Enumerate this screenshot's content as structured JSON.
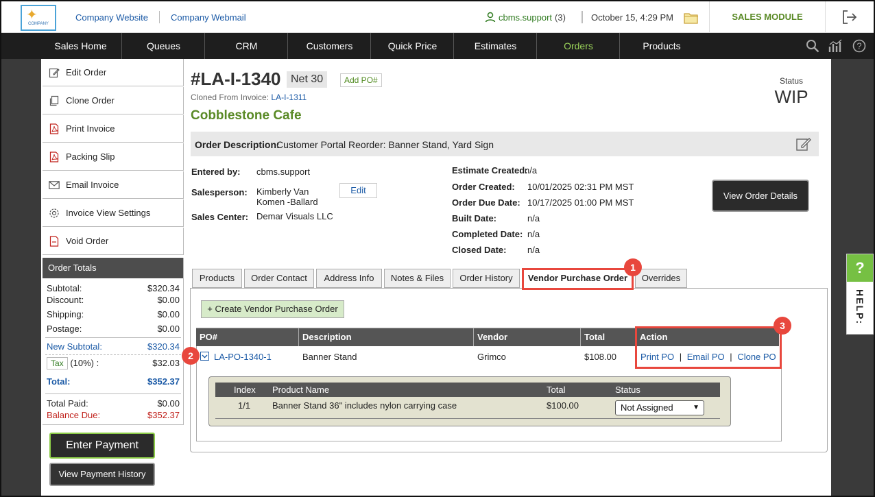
{
  "header": {
    "logo_text": "COMPANY",
    "links": [
      "Company Website",
      "Company Webmail"
    ],
    "user": "cbms.support",
    "user_count": "(3)",
    "datetime": "October 15, 4:29 PM",
    "module": "SALES MODULE"
  },
  "nav": {
    "items": [
      "Sales Home",
      "Queues",
      "CRM",
      "Customers",
      "Quick Price",
      "Estimates",
      "Orders",
      "Products"
    ],
    "active": "Orders"
  },
  "sidebar": {
    "actions": [
      "Edit Order",
      "Clone Order",
      "Print Invoice",
      "Packing Slip",
      "Email Invoice",
      "Invoice View Settings",
      "Void Order"
    ],
    "totals_title": "Order Totals",
    "totals": {
      "subtotal_label": "Subtotal:",
      "subtotal": "$320.34",
      "discount_label": "Discount:",
      "discount": "$0.00",
      "shipping_label": "Shipping:",
      "shipping": "$0.00",
      "postage_label": "Postage:",
      "postage": "$0.00",
      "new_subtotal_label": "New Subtotal:",
      "new_subtotal": "$320.34",
      "tax_tag": "Tax",
      "tax_rate": "(10%) :",
      "tax": "$32.03",
      "total_label": "Total:",
      "total": "$352.37",
      "paid_label": "Total Paid:",
      "paid": "$0.00",
      "balance_label": "Balance Due:",
      "balance": "$352.37"
    },
    "enter_payment": "Enter Payment",
    "view_payment_history": "View Payment History"
  },
  "order": {
    "number": "#LA-I-1340",
    "terms": "Net 30",
    "add_po": "Add PO#",
    "cloned_from_label": "Cloned From Invoice:",
    "cloned_from": "LA-I-1311",
    "customer": "Cobblestone Cafe",
    "status_label": "Status",
    "status": "WIP",
    "description_label": "Order Description:",
    "description": "Customer Portal Reorder: Banner Stand, Yard Sign",
    "entered_by_label": "Entered by:",
    "entered_by": "cbms.support",
    "salesperson_label": "Salesperson:",
    "salesperson_line1": "Kimberly Van",
    "salesperson_line2": "Komen -Ballard",
    "edit": "Edit",
    "sales_center_label": "Sales Center:",
    "sales_center": "Demar Visuals LLC",
    "estimate_created_label": "Estimate Created:",
    "estimate_created": "n/a",
    "order_created_label": "Order Created:",
    "order_created": "10/01/2025 02:31 PM MST",
    "order_due_label": "Order Due Date:",
    "order_due": "10/17/2025 01:00 PM MST",
    "built_label": "Built Date:",
    "built": "n/a",
    "completed_label": "Completed Date:",
    "completed": "n/a",
    "closed_label": "Closed Date:",
    "closed": "n/a",
    "view_details": "View Order Details"
  },
  "tabs": [
    "Products",
    "Order Contact",
    "Address Info",
    "Notes & Files",
    "Order History",
    "Vendor Purchase Order",
    "Overrides"
  ],
  "active_tab": "Vendor Purchase Order",
  "vendor_po": {
    "create_button": "+ Create Vendor Purchase Order",
    "columns": [
      "PO#",
      "Description",
      "Vendor",
      "Total",
      "Action"
    ],
    "row": {
      "po": "LA-PO-1340-1",
      "description": "Banner Stand",
      "vendor": "Grimco",
      "total": "$108.00",
      "actions": [
        "Print PO",
        "Email PO",
        "Clone PO"
      ],
      "action_sep": "|"
    },
    "sub_columns": [
      "Index",
      "Product Name",
      "Total",
      "Status"
    ],
    "sub_row": {
      "index": "1/1",
      "product": "Banner Stand 36\" includes nylon carrying case",
      "total": "$100.00",
      "status": "Not Assigned"
    }
  },
  "annotations": [
    "1",
    "2",
    "3"
  ],
  "help": {
    "q": "?",
    "label": "HELP:"
  },
  "colors": {
    "accent_green": "#5a8a26",
    "link_blue": "#1b5aa6",
    "annotation_red": "#e8473d",
    "nav_bg": "#1e1e1e"
  }
}
